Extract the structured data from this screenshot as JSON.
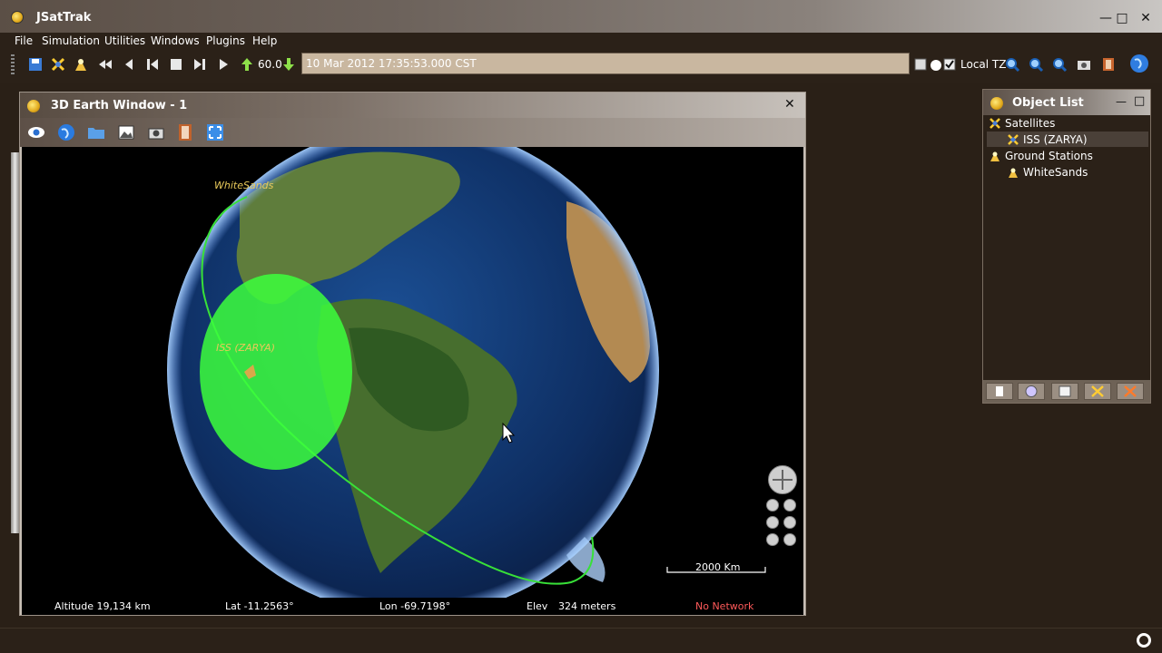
{
  "app": {
    "title": "JSatTrak"
  },
  "menu": {
    "items": [
      "File",
      "Simulation",
      "Utilities",
      "Windows",
      "Plugins",
      "Help"
    ]
  },
  "toolbar": {
    "speed": "60.0",
    "time": "10 Mar 2012 17:35:53.000 CST",
    "local_tz_label": "Local TZ"
  },
  "earth_window": {
    "title": "3D Earth Window - 1",
    "labels": {
      "ground_station": "WhiteSands",
      "satellite": "ISS (ZARYA)"
    },
    "scale": "2000 Km",
    "status": {
      "altitude": "Altitude 19,134 km",
      "lat": "Lat -11.2563°",
      "lon": "Lon -69.7198°",
      "elev_label": "Elev",
      "elev_value": "324 meters",
      "network": "No Network"
    },
    "colors": {
      "footprint": "#3cff3c",
      "orbit": "#38e038",
      "no_network": "#ff5a5a",
      "label": "#e8c95a"
    }
  },
  "object_list": {
    "title": "Object List",
    "groups": [
      {
        "label": "Satellites",
        "children": [
          "ISS (ZARYA)"
        ]
      },
      {
        "label": "Ground Stations",
        "children": [
          "WhiteSands"
        ]
      }
    ]
  }
}
